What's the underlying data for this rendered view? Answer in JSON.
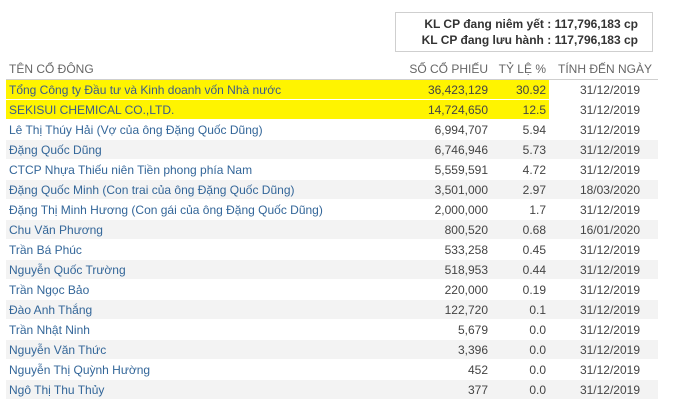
{
  "summary": {
    "listed_label": "KL CP đang niêm yết :",
    "listed_value": "117,796,183 cp",
    "outstanding_label": "KL CP đang lưu hành :",
    "outstanding_value": "117,796,183 cp"
  },
  "table": {
    "headers": [
      "TÊN CỔ ĐÔNG",
      "SỐ CỔ PHIẾU",
      "TỶ LỆ %",
      "TÍNH ĐẾN NGÀY"
    ],
    "rows": [
      {
        "name": "Tổng Công ty Đầu tư và Kinh doanh vốn Nhà nước",
        "shares": "36,423,129",
        "ratio": "30.92",
        "date": "31/12/2019",
        "highlighted": true
      },
      {
        "name": "SEKISUI CHEMICAL CO.,LTD.",
        "shares": "14,724,650",
        "ratio": "12.5",
        "date": "31/12/2019",
        "highlighted": true
      },
      {
        "name": "Lê Thị Thúy Hải (Vợ của ông Đặng Quốc Dũng)",
        "shares": "6,994,707",
        "ratio": "5.94",
        "date": "31/12/2019"
      },
      {
        "name": "Đặng Quốc Dũng",
        "shares": "6,746,946",
        "ratio": "5.73",
        "date": "31/12/2019"
      },
      {
        "name": "CTCP Nhựa Thiếu niên Tiền phong phía Nam",
        "shares": "5,559,591",
        "ratio": "4.72",
        "date": "31/12/2019"
      },
      {
        "name": "Đặng Quốc Minh (Con trai của ông Đặng Quốc Dũng)",
        "shares": "3,501,000",
        "ratio": "2.97",
        "date": "18/03/2020"
      },
      {
        "name": "Đặng Thị Minh Hương (Con gái của ông Đặng Quốc Dũng)",
        "shares": "2,000,000",
        "ratio": "1.7",
        "date": "31/12/2019"
      },
      {
        "name": "Chu Văn Phương",
        "shares": "800,520",
        "ratio": "0.68",
        "date": "16/01/2020"
      },
      {
        "name": "Trần Bá Phúc",
        "shares": "533,258",
        "ratio": "0.45",
        "date": "31/12/2019"
      },
      {
        "name": "Nguyễn Quốc Trường",
        "shares": "518,953",
        "ratio": "0.44",
        "date": "31/12/2019"
      },
      {
        "name": "Trần Ngọc Bảo",
        "shares": "220,000",
        "ratio": "0.19",
        "date": "31/12/2019"
      },
      {
        "name": "Đào Anh Thắng",
        "shares": "122,720",
        "ratio": "0.1",
        "date": "31/12/2019"
      },
      {
        "name": "Trần Nhật Ninh",
        "shares": "5,679",
        "ratio": "0.0",
        "date": "31/12/2019"
      },
      {
        "name": "Nguyễn Văn Thức",
        "shares": "3,396",
        "ratio": "0.0",
        "date": "31/12/2019"
      },
      {
        "name": "Nguyễn Thị Quỳnh Hường",
        "shares": "452",
        "ratio": "0.0",
        "date": "31/12/2019"
      },
      {
        "name": "Ngô Thị Thu Thủy",
        "shares": "377",
        "ratio": "0.0",
        "date": "31/12/2019"
      }
    ]
  },
  "colors": {
    "highlight": "#fff400",
    "link": "#336699"
  }
}
